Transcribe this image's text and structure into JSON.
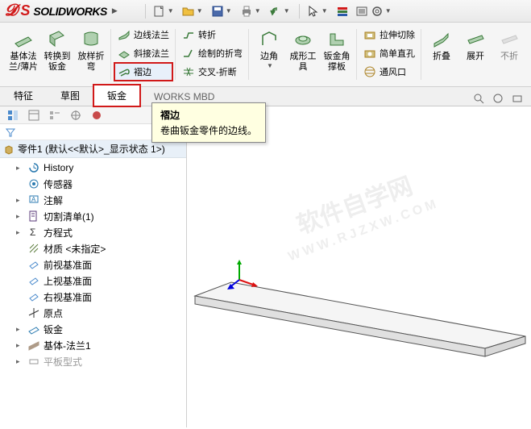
{
  "app": {
    "brand_letter": "S",
    "brand_text": "SOLIDWORKS"
  },
  "ribbon": {
    "big": [
      {
        "label": "基体法\n兰/薄片"
      },
      {
        "label": "转换到\n钣金"
      },
      {
        "label": "放样折\n弯"
      }
    ],
    "col1": [
      {
        "label": "边线法兰"
      },
      {
        "label": "斜接法兰"
      },
      {
        "label": "褶边",
        "highlighted": true
      }
    ],
    "col2": [
      {
        "label": "转折"
      },
      {
        "label": "绘制的折弯"
      },
      {
        "label": "交叉-折断"
      }
    ],
    "big2": [
      {
        "label": "边角"
      },
      {
        "label": "成形工\n具"
      },
      {
        "label": "钣金角\n撑板"
      }
    ],
    "col3": [
      {
        "label": "拉伸切除"
      },
      {
        "label": "简单直孔"
      },
      {
        "label": "通风口"
      }
    ],
    "big3": [
      {
        "label": "折叠"
      },
      {
        "label": "展开"
      },
      {
        "label": "不折",
        "disabled": true
      }
    ]
  },
  "tabs": {
    "items": [
      "特征",
      "草图",
      "钣金"
    ],
    "active_index": 2,
    "extra": "WORKS MBD"
  },
  "tooltip": {
    "title": "褶边",
    "body": "卷曲钣金零件的边线。"
  },
  "tree": {
    "root": "零件1 (默认<<默认>_显示状态 1>)",
    "items": [
      {
        "label": "History",
        "icon": "history",
        "color": "#2a7ab0",
        "expand": "▸"
      },
      {
        "label": "传感器",
        "icon": "sensor",
        "color": "#2a7ab0"
      },
      {
        "label": "注解",
        "icon": "annotation",
        "color": "#2a7ab0",
        "expand": "▸"
      },
      {
        "label": "切割清单(1)",
        "icon": "cutlist",
        "color": "#5a3a7a",
        "expand": "▸"
      },
      {
        "label": "方程式",
        "icon": "equation",
        "color": "#333",
        "expand": "▸"
      },
      {
        "label": "材质 <未指定>",
        "icon": "material",
        "color": "#5a7a3a"
      },
      {
        "label": "前视基准面",
        "icon": "plane",
        "color": "#4a8acc"
      },
      {
        "label": "上视基准面",
        "icon": "plane",
        "color": "#4a8acc"
      },
      {
        "label": "右视基准面",
        "icon": "plane",
        "color": "#4a8acc"
      },
      {
        "label": "原点",
        "icon": "origin",
        "color": "#333"
      },
      {
        "label": "钣金",
        "icon": "sheetmetal",
        "color": "#2a7ab0",
        "expand": "▸"
      },
      {
        "label": "基体-法兰1",
        "icon": "baseflange",
        "color": "#7a5a3a",
        "expand": "▸"
      },
      {
        "label": "平板型式",
        "icon": "flatpattern",
        "color": "#999",
        "disabled": true,
        "expand": "▸"
      }
    ]
  },
  "watermark": {
    "line1": "软件自学网",
    "line2": "WWW.RJZXW.COM"
  }
}
